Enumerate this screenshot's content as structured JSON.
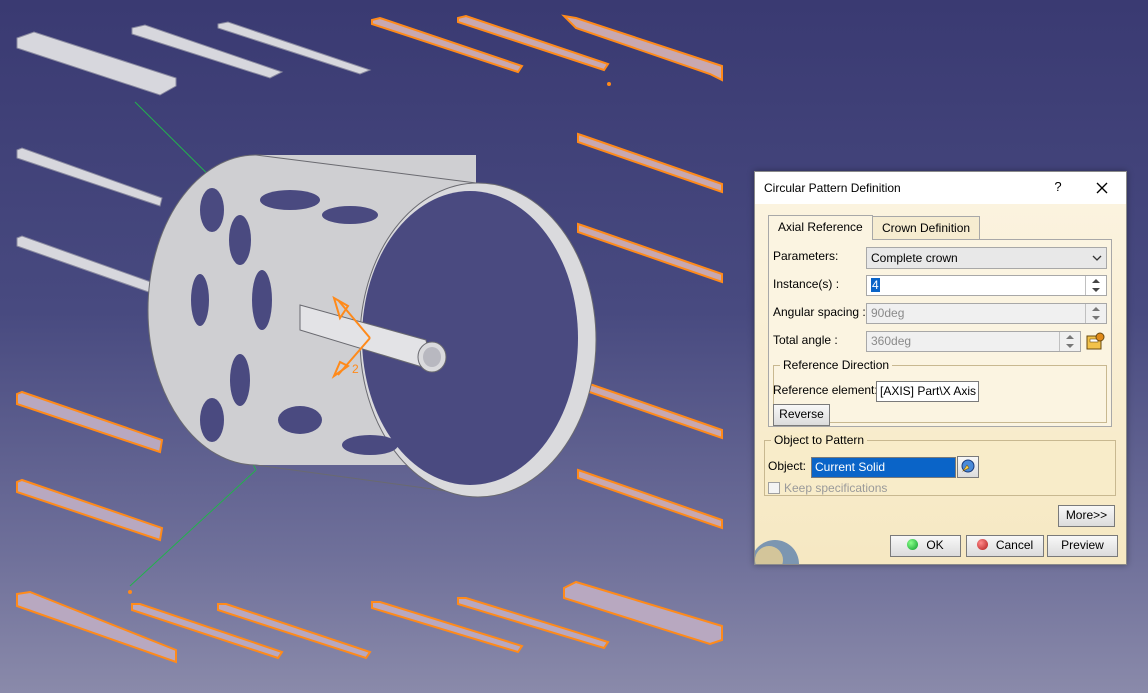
{
  "viewport": {
    "colors": {
      "bg_top": "#3a3a72",
      "bg_bottom": "#8a8aaa",
      "part": "#d7d7d7",
      "selected": "#ff8a1a",
      "axis": "#22b24c"
    },
    "axis_marker_label": "2"
  },
  "dialog": {
    "title": "Circular Pattern Definition",
    "help_label": "?",
    "tabs": [
      {
        "label": "Axial Reference",
        "active": true
      },
      {
        "label": "Crown Definition",
        "active": false
      }
    ],
    "parameters": {
      "label": "Parameters:",
      "value": "Complete crown"
    },
    "instances": {
      "label": "Instance(s) :",
      "value": "4"
    },
    "angular_spacing": {
      "label": "Angular spacing :",
      "value": "90deg"
    },
    "total_angle": {
      "label": "Total angle :",
      "value": "360deg"
    },
    "reference_direction": {
      "legend": "Reference Direction",
      "label": "Reference element:",
      "value": "[AXIS] Part\\X Axis",
      "reverse_label": "Reverse"
    },
    "object_to_pattern": {
      "legend": "Object to Pattern",
      "label": "Object:",
      "value": "Current Solid",
      "keep_spec_label": "Keep specifications"
    },
    "more_label": "More>>",
    "ok_label": "OK",
    "cancel_label": "Cancel",
    "preview_label": "Preview"
  }
}
